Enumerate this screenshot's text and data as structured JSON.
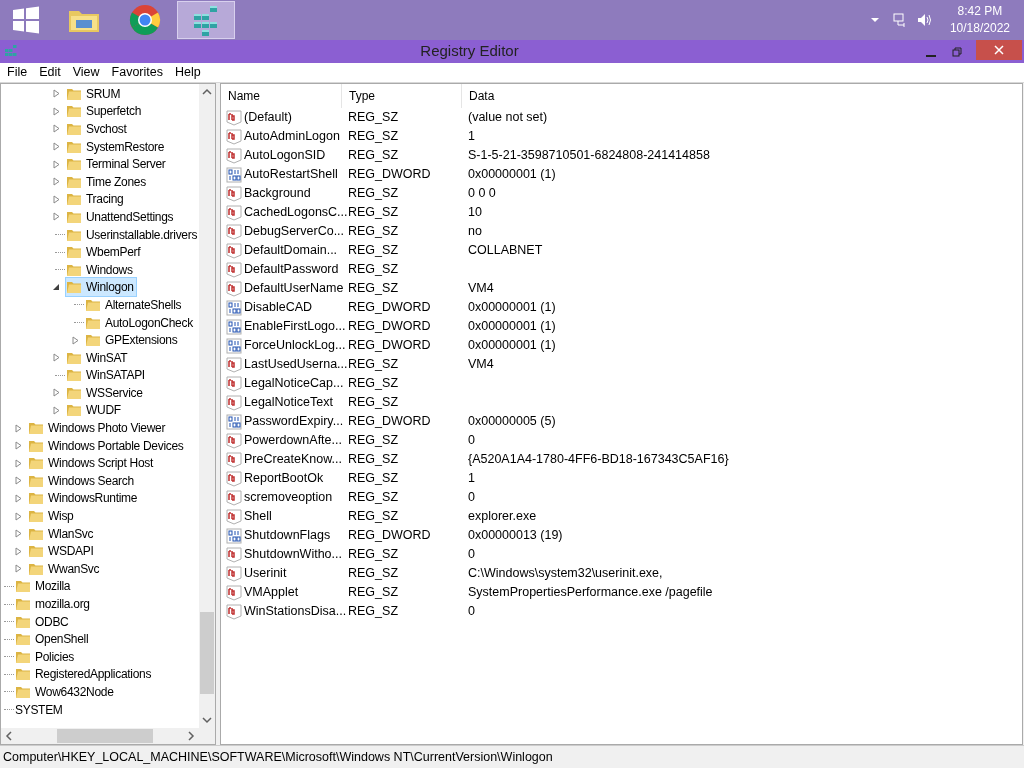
{
  "taskbar": {
    "apps": [
      {
        "kind": "explorer",
        "selected": false
      },
      {
        "kind": "chrome",
        "selected": false
      },
      {
        "kind": "regedit",
        "selected": true
      }
    ],
    "clock": {
      "time": "8:42 PM",
      "date": "10/18/2022"
    }
  },
  "window": {
    "title": "Registry Editor"
  },
  "menu": [
    "File",
    "Edit",
    "View",
    "Favorites",
    "Help"
  ],
  "tree": {
    "items": [
      {
        "children": [
          {
            "children": [
              {
                "children": [
                  {
                    "label": "SRUM",
                    "expanded": false,
                    "selected": false
                  },
                  {
                    "label": "Superfetch",
                    "expanded": false,
                    "selected": false
                  },
                  {
                    "label": "Svchost",
                    "expanded": false,
                    "selected": false
                  },
                  {
                    "label": "SystemRestore",
                    "expanded": false,
                    "selected": false
                  },
                  {
                    "label": "Terminal Server",
                    "expanded": false,
                    "selected": false
                  },
                  {
                    "label": "Time Zones",
                    "expanded": false,
                    "selected": false
                  },
                  {
                    "label": "Tracing",
                    "expanded": false,
                    "selected": false
                  },
                  {
                    "label": "UnattendSettings",
                    "expanded": false,
                    "selected": false
                  },
                  {
                    "label": "Userinstallable.drivers",
                    "selected": false
                  },
                  {
                    "label": "WbemPerf",
                    "selected": false
                  },
                  {
                    "label": "Windows",
                    "selected": false
                  },
                  {
                    "label": "Winlogon",
                    "expanded": true,
                    "selected": true,
                    "children": [
                      {
                        "label": "AlternateShells",
                        "selected": false
                      },
                      {
                        "label": "AutoLogonCheck",
                        "selected": false
                      },
                      {
                        "label": "GPExtensions",
                        "expanded": false,
                        "selected": false
                      }
                    ]
                  },
                  {
                    "label": "WinSAT",
                    "expanded": false,
                    "selected": false
                  },
                  {
                    "label": "WinSATAPI",
                    "selected": false
                  },
                  {
                    "label": "WSService",
                    "expanded": false,
                    "selected": false
                  },
                  {
                    "label": "WUDF",
                    "expanded": false,
                    "selected": false
                  }
                ]
              }
            ]
          },
          {
            "label": "Windows Photo Viewer",
            "expanded": false,
            "selected": false
          },
          {
            "label": "Windows Portable Devices",
            "expanded": false,
            "selected": false
          },
          {
            "label": "Windows Script Host",
            "expanded": false,
            "selected": false
          },
          {
            "label": "Windows Search",
            "expanded": false,
            "selected": false
          },
          {
            "label": "WindowsRuntime",
            "expanded": false,
            "selected": false
          },
          {
            "label": "Wisp",
            "expanded": false,
            "selected": false
          },
          {
            "label": "WlanSvc",
            "expanded": false,
            "selected": false
          },
          {
            "label": "WSDAPI",
            "expanded": false,
            "selected": false
          },
          {
            "label": "WwanSvc",
            "expanded": false,
            "selected": false
          }
        ]
      },
      {
        "label": "Mozilla",
        "selected": false
      },
      {
        "label": "mozilla.org",
        "selected": false
      },
      {
        "label": "ODBC",
        "selected": false
      },
      {
        "label": "OpenShell",
        "selected": false
      },
      {
        "label": "Policies",
        "selected": false
      },
      {
        "label": "RegisteredApplications",
        "selected": false
      },
      {
        "label": "Wow6432Node",
        "selected": false
      },
      {
        "label": "SYSTEM",
        "selected": false,
        "kind": "hive"
      }
    ]
  },
  "values": {
    "columns": [
      "Name",
      "Type",
      "Data"
    ],
    "rows": [
      {
        "kind": "string",
        "name": "(Default)",
        "type": "REG_SZ",
        "data": "(value not set)"
      },
      {
        "kind": "string",
        "name": "AutoAdminLogon",
        "type": "REG_SZ",
        "data": "1"
      },
      {
        "kind": "string",
        "name": "AutoLogonSID",
        "type": "REG_SZ",
        "data": "S-1-5-21-3598710501-6824808-241414858"
      },
      {
        "kind": "binary",
        "name": "AutoRestartShell",
        "type": "REG_DWORD",
        "data": "0x00000001 (1)"
      },
      {
        "kind": "string",
        "name": "Background",
        "type": "REG_SZ",
        "data": "0 0 0"
      },
      {
        "kind": "string",
        "name": "CachedLogonsC...",
        "type": "REG_SZ",
        "data": "10"
      },
      {
        "kind": "string",
        "name": "DebugServerCo...",
        "type": "REG_SZ",
        "data": "no"
      },
      {
        "kind": "string",
        "name": "DefaultDomain...",
        "type": "REG_SZ",
        "data": "COLLABNET"
      },
      {
        "kind": "string",
        "name": "DefaultPassword",
        "type": "REG_SZ"
      },
      {
        "kind": "string",
        "name": "DefaultUserName",
        "type": "REG_SZ",
        "data": "VM4"
      },
      {
        "kind": "binary",
        "name": "DisableCAD",
        "type": "REG_DWORD",
        "data": "0x00000001 (1)"
      },
      {
        "kind": "binary",
        "name": "EnableFirstLogo...",
        "type": "REG_DWORD",
        "data": "0x00000001 (1)"
      },
      {
        "kind": "binary",
        "name": "ForceUnlockLog...",
        "type": "REG_DWORD",
        "data": "0x00000001 (1)"
      },
      {
        "kind": "string",
        "name": "LastUsedUserna...",
        "type": "REG_SZ",
        "data": "VM4"
      },
      {
        "kind": "string",
        "name": "LegalNoticeCap...",
        "type": "REG_SZ"
      },
      {
        "kind": "string",
        "name": "LegalNoticeText",
        "type": "REG_SZ"
      },
      {
        "kind": "binary",
        "name": "PasswordExpiry...",
        "type": "REG_DWORD",
        "data": "0x00000005 (5)"
      },
      {
        "kind": "string",
        "name": "PowerdownAfte...",
        "type": "REG_SZ",
        "data": "0"
      },
      {
        "kind": "string",
        "name": "PreCreateKnow...",
        "type": "REG_SZ",
        "data": "{A520A1A4-1780-4FF6-BD18-167343C5AF16}"
      },
      {
        "kind": "string",
        "name": "ReportBootOk",
        "type": "REG_SZ",
        "data": "1"
      },
      {
        "kind": "string",
        "name": "scremoveoption",
        "type": "REG_SZ",
        "data": "0"
      },
      {
        "kind": "string",
        "name": "Shell",
        "type": "REG_SZ",
        "data": "explorer.exe"
      },
      {
        "kind": "binary",
        "name": "ShutdownFlags",
        "type": "REG_DWORD",
        "data": "0x00000013 (19)"
      },
      {
        "kind": "string",
        "name": "ShutdownWitho...",
        "type": "REG_SZ",
        "data": "0"
      },
      {
        "kind": "string",
        "name": "Userinit",
        "type": "REG_SZ",
        "data": "C:\\Windows\\system32\\userinit.exe,"
      },
      {
        "kind": "string",
        "name": "VMApplet",
        "type": "REG_SZ",
        "data": "SystemPropertiesPerformance.exe /pagefile"
      },
      {
        "kind": "string",
        "name": "WinStationsDisa...",
        "type": "REG_SZ",
        "data": "0"
      }
    ]
  },
  "status_bar": "Computer\\HKEY_LOCAL_MACHINE\\SOFTWARE\\Microsoft\\Windows NT\\CurrentVersion\\Winlogon"
}
